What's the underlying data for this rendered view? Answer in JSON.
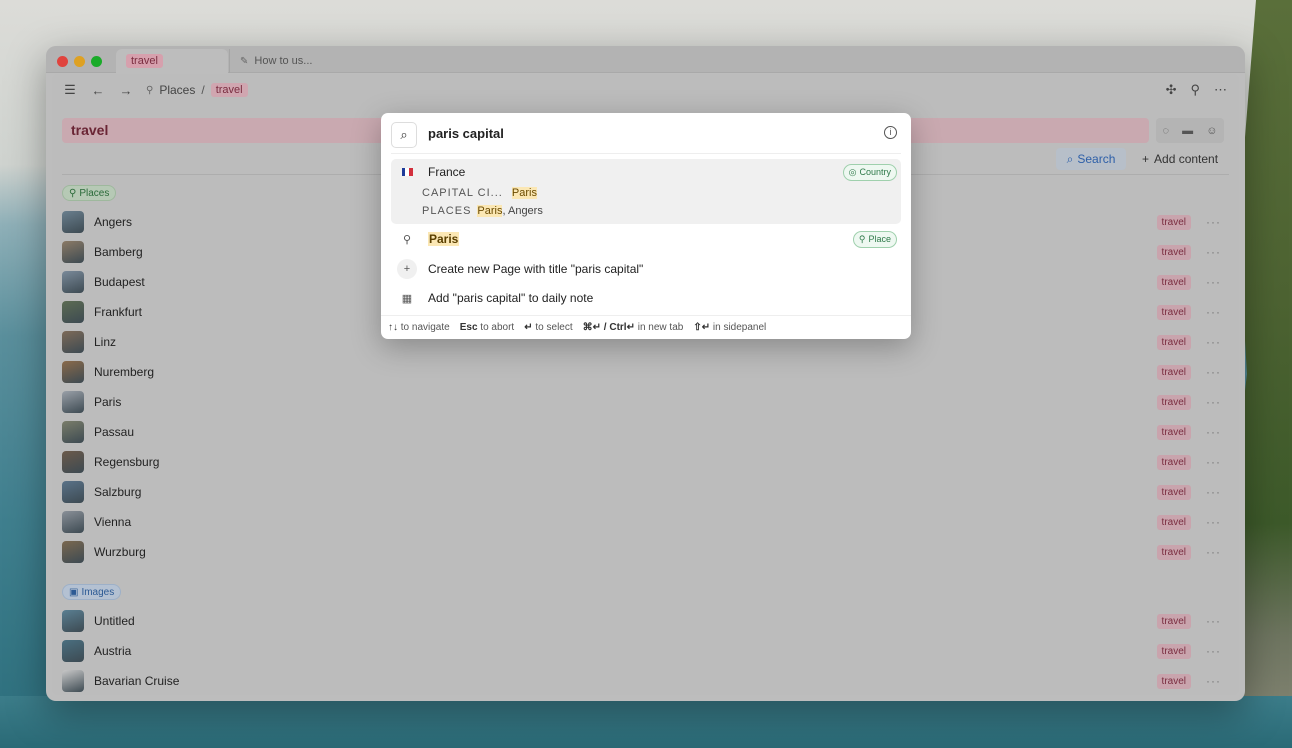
{
  "window": {
    "tabs": [
      {
        "label": "travel",
        "active": true
      },
      {
        "label": "How to us...",
        "active": false
      }
    ]
  },
  "breadcrumb": {
    "parent": "Places",
    "separator": "/",
    "current": "travel"
  },
  "page": {
    "title": "travel",
    "search_label": "Search",
    "add_content_label": "Add content"
  },
  "sections": {
    "places": {
      "label": "Places",
      "items": [
        {
          "name": "Angers",
          "tag": "travel"
        },
        {
          "name": "Bamberg",
          "tag": "travel"
        },
        {
          "name": "Budapest",
          "tag": "travel"
        },
        {
          "name": "Frankfurt",
          "tag": "travel"
        },
        {
          "name": "Linz",
          "tag": "travel"
        },
        {
          "name": "Nuremberg",
          "tag": "travel"
        },
        {
          "name": "Paris",
          "tag": "travel"
        },
        {
          "name": "Passau",
          "tag": "travel"
        },
        {
          "name": "Regensburg",
          "tag": "travel"
        },
        {
          "name": "Salzburg",
          "tag": "travel"
        },
        {
          "name": "Vienna",
          "tag": "travel"
        },
        {
          "name": "Wurzburg",
          "tag": "travel"
        }
      ]
    },
    "images": {
      "label": "Images",
      "items": [
        {
          "name": "Untitled",
          "tag": "travel"
        },
        {
          "name": "Austria",
          "tag": "travel"
        },
        {
          "name": "Bavarian Cruise",
          "tag": "travel"
        }
      ]
    }
  },
  "modal": {
    "query": "paris capital",
    "results": {
      "france": {
        "label": "France",
        "tag": "Country",
        "capital_key": "CAPITAL CI...",
        "capital_value": "Paris",
        "places_key": "PLACES",
        "places_value_hl": "Paris",
        "places_value_rest": ", Angers"
      },
      "paris": {
        "label": "Paris",
        "tag": "Place"
      },
      "create": {
        "label": "Create new Page with title \"paris capital\""
      },
      "daily": {
        "label": "Add \"paris capital\" to daily note"
      }
    },
    "footer": {
      "navigate_keys": "↑↓",
      "navigate_text": "to navigate",
      "abort_key": "Esc",
      "abort_text": "to abort",
      "select_key": "↵",
      "select_text": "to select",
      "newtab_key": "⌘↵ / Ctrl↵",
      "newtab_text": "in new tab",
      "sidepanel_key": "⇧↵",
      "sidepanel_text": "in sidepanel"
    }
  },
  "colors": {
    "tag_bg": "#c9a4ad",
    "tag_text": "#7a2d40",
    "highlight": "#fbe7b4",
    "accent_blue": "#2d5fa8"
  }
}
